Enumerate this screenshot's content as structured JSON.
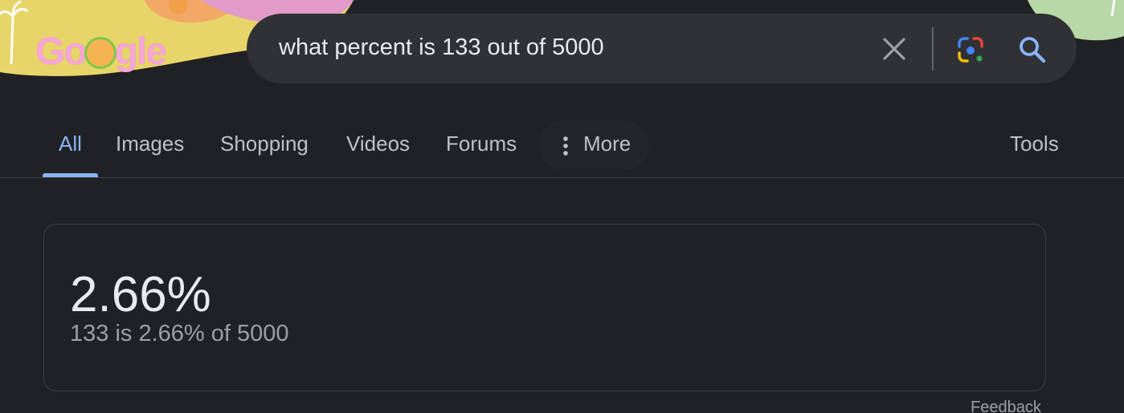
{
  "logo": {
    "text_left": "Go",
    "text_right": "gle"
  },
  "search": {
    "query": "what percent is 133 out of 5000",
    "clear_icon": "close-icon",
    "lens_icon": "google-lens-icon",
    "search_icon": "search-icon"
  },
  "tabs": [
    {
      "label": "All",
      "active": true
    },
    {
      "label": "Images"
    },
    {
      "label": "Shopping"
    },
    {
      "label": "Videos"
    },
    {
      "label": "Forums"
    },
    {
      "label": "More"
    }
  ],
  "tools_label": "Tools",
  "result": {
    "value": "2.66%",
    "explanation": "133 is 2.66% of 5000"
  },
  "feedback_label": "Feedback",
  "colors": {
    "background": "#202124",
    "search_bg": "#303134",
    "accent": "#8ab4f8",
    "text": "#e8eaed",
    "muted": "#9aa0a6"
  }
}
